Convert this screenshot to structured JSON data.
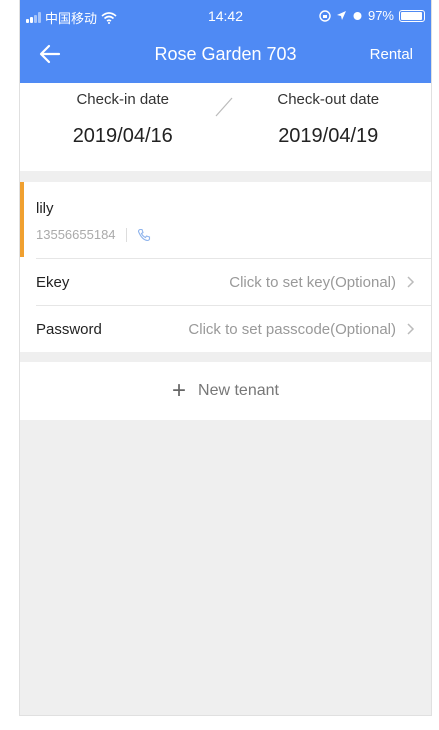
{
  "status_bar": {
    "carrier": "中国移动",
    "time": "14:42",
    "battery": "97%",
    "battery_level": 0.97
  },
  "nav": {
    "title": "Rose Garden 703",
    "action": "Rental",
    "back_icon": "arrow-left-icon"
  },
  "dates": {
    "checkin_label": "Check-in date",
    "checkin_value": "2019/04/16",
    "checkout_label": "Check-out date",
    "checkout_value": "2019/04/19"
  },
  "tenant": {
    "name": "lily",
    "phone": "13556655184",
    "ekey_label": "Ekey",
    "ekey_value": "Click to set key(Optional)",
    "password_label": "Password",
    "password_value": "Click to set passcode(Optional)"
  },
  "new_tenant": {
    "label": "New tenant"
  },
  "colors": {
    "header": "#4f8af4",
    "accent": "#f0a030",
    "background": "#efefef"
  }
}
